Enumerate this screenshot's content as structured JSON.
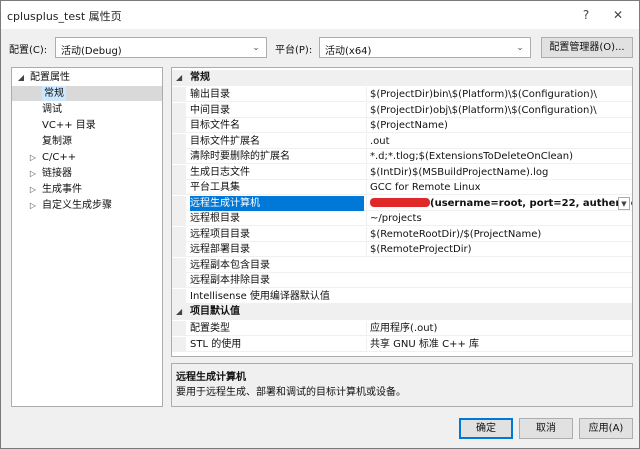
{
  "window": {
    "title": "cplusplus_test 属性页",
    "help_glyph": "?",
    "close_glyph": "✕"
  },
  "config_bar": {
    "config_label": "配置(C):",
    "config_value": "活动(Debug)",
    "platform_label": "平台(P):",
    "platform_value": "活动(x64)",
    "manager_button": "配置管理器(O)..."
  },
  "tree": {
    "items": [
      {
        "label": "配置属性",
        "twisty": "◢",
        "indent": 0
      },
      {
        "label": "常规",
        "twisty": "",
        "indent": 1
      },
      {
        "label": "调试",
        "twisty": "",
        "indent": 1
      },
      {
        "label": "VC++ 目录",
        "twisty": "",
        "indent": 1
      },
      {
        "label": "复制源",
        "twisty": "",
        "indent": 1
      },
      {
        "label": "C/C++",
        "twisty": "▷",
        "indent": 1
      },
      {
        "label": "链接器",
        "twisty": "▷",
        "indent": 1
      },
      {
        "label": "生成事件",
        "twisty": "▷",
        "indent": 1
      },
      {
        "label": "自定义生成步骤",
        "twisty": "▷",
        "indent": 1
      }
    ],
    "selected_index": 1
  },
  "grid": {
    "categories": [
      {
        "name": "常规",
        "twisty": "◢",
        "rows": [
          {
            "name": "输出目录",
            "value": "$(ProjectDir)bin\\$(Platform)\\$(Configuration)\\"
          },
          {
            "name": "中间目录",
            "value": "$(ProjectDir)obj\\$(Platform)\\$(Configuration)\\"
          },
          {
            "name": "目标文件名",
            "value": "$(ProjectName)"
          },
          {
            "name": "目标文件扩展名",
            "value": ".out"
          },
          {
            "name": "清除时要删除的扩展名",
            "value": "*.d;*.tlog;$(ExtensionsToDeleteOnClean)"
          },
          {
            "name": "生成日志文件",
            "value": "$(IntDir)$(MSBuildProjectName).log"
          },
          {
            "name": "平台工具集",
            "value": "GCC for Remote Linux"
          },
          {
            "name": "远程生成计算机",
            "value": "(username=root, port=22, authenticat"
          },
          {
            "name": "远程根目录",
            "value": "~/projects"
          },
          {
            "name": "远程项目目录",
            "value": "$(RemoteRootDir)/$(ProjectName)"
          },
          {
            "name": "远程部署目录",
            "value": "$(RemoteProjectDir)"
          },
          {
            "name": "远程副本包含目录",
            "value": ""
          },
          {
            "name": "远程副本排除目录",
            "value": ""
          },
          {
            "name": "Intellisense 使用编译器默认值",
            "value": ""
          }
        ]
      },
      {
        "name": "项目默认值",
        "twisty": "◢",
        "rows": [
          {
            "name": "配置类型",
            "value": "应用程序(.out)"
          },
          {
            "name": "STL 的使用",
            "value": "共享 GNU 标准 C++ 库"
          }
        ]
      }
    ],
    "selected_row_name": "远程生成计算机",
    "dropdown_glyph": "▼"
  },
  "description": {
    "title": "远程生成计算机",
    "text": "要用于远程生成、部署和调试的目标计算机或设备。"
  },
  "footer": {
    "ok": "确定",
    "cancel": "取消",
    "apply": "应用(A)"
  },
  "colors": {
    "selection_blue": "#0078d7",
    "redaction": "#dd1111"
  }
}
